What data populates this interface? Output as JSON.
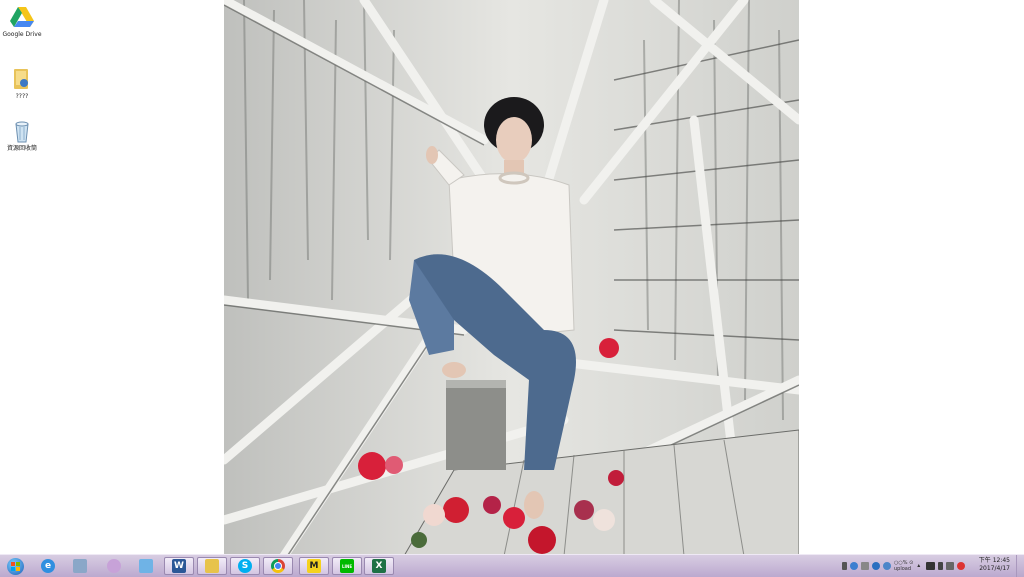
{
  "desktop": {
    "icons": [
      {
        "label": "Google Drive"
      },
      {
        "label": "????"
      },
      {
        "label": "資源回收筒"
      }
    ]
  },
  "taskbar": {
    "pinned": [
      {
        "name": "start",
        "glyph": ""
      },
      {
        "name": "internet-explorer",
        "glyph": "e"
      },
      {
        "name": "calculator",
        "glyph": ""
      },
      {
        "name": "paint",
        "glyph": ""
      },
      {
        "name": "notepad",
        "glyph": ""
      },
      {
        "name": "word",
        "glyph": "W"
      },
      {
        "name": "folder",
        "glyph": ""
      },
      {
        "name": "skype",
        "glyph": "S"
      },
      {
        "name": "chrome",
        "glyph": ""
      },
      {
        "name": "malwarebytes",
        "glyph": "M"
      },
      {
        "name": "line",
        "glyph": "LINE"
      },
      {
        "name": "excel",
        "glyph": "X"
      }
    ],
    "tray_text": "○○% ⊙",
    "tray_sub": "upload",
    "clock_time": "下午 12:45",
    "clock_date": "2017/4/17"
  },
  "colors": {
    "taskbar_top": "#d8cde2",
    "taskbar_bottom": "#bba9cf",
    "flower_red": "#d8203a"
  }
}
